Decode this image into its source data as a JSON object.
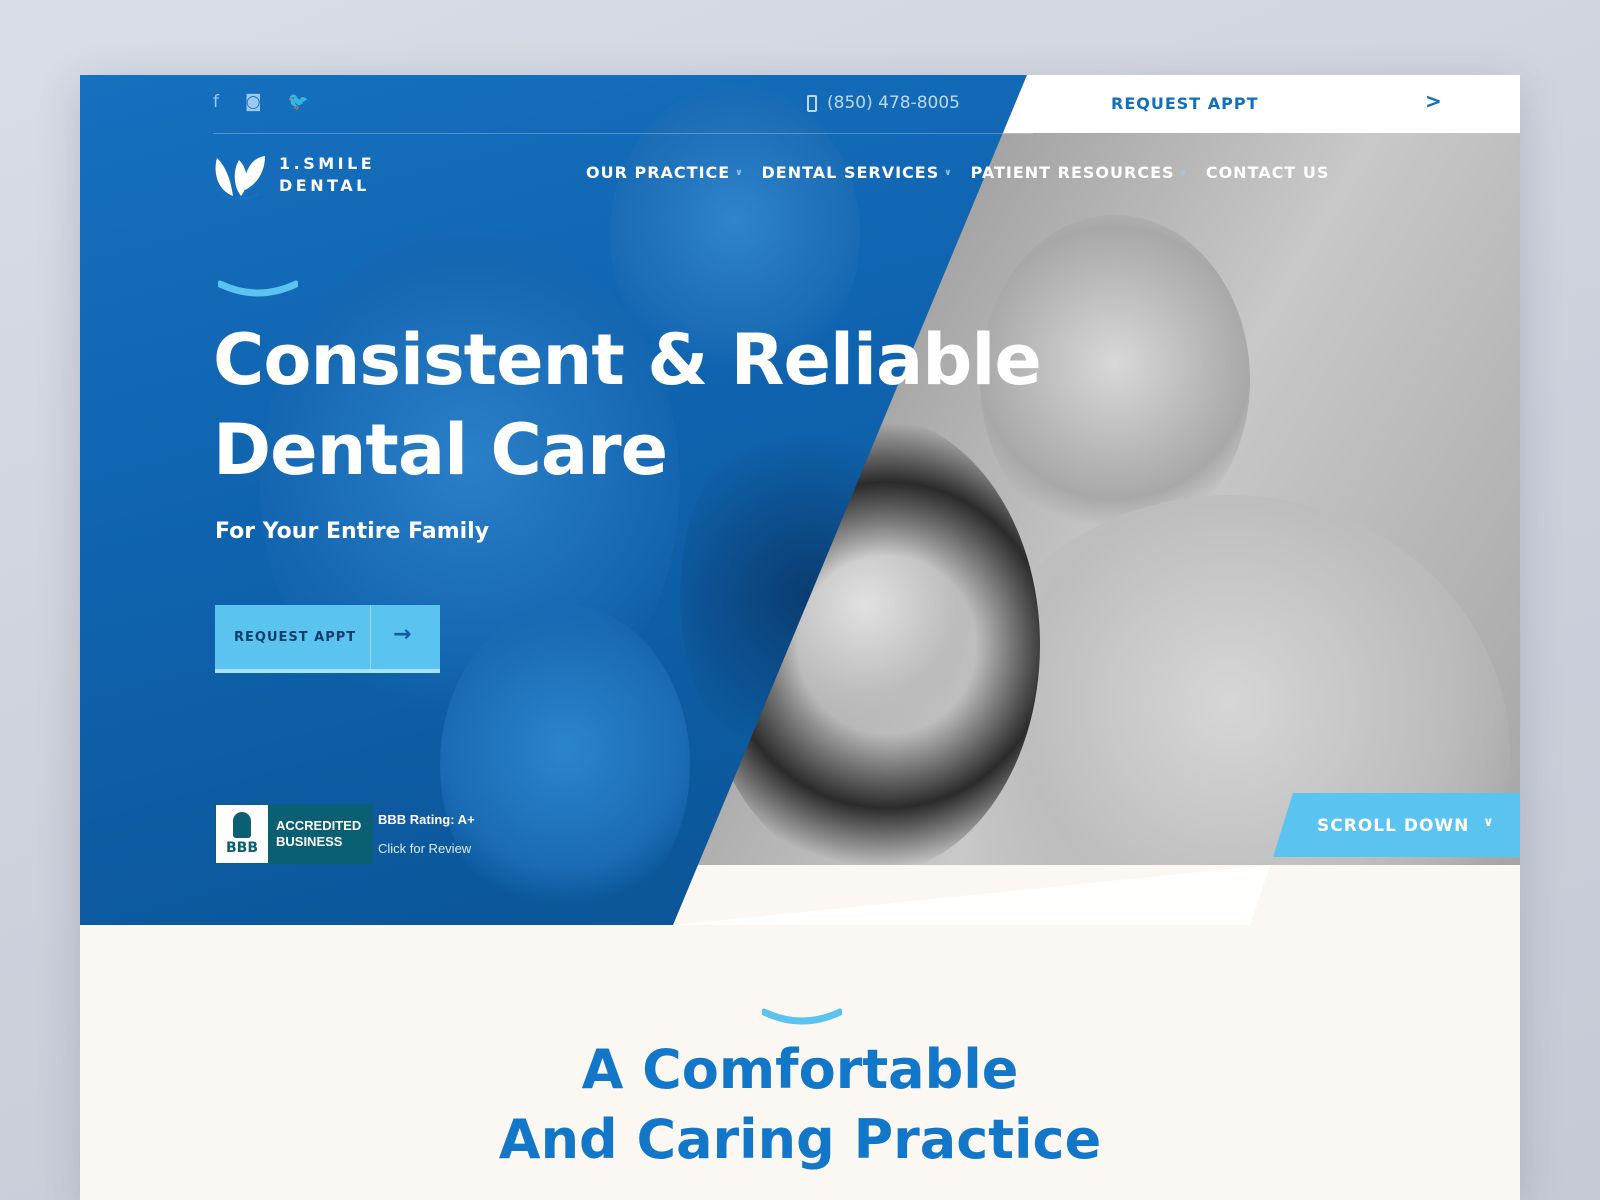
{
  "social": {
    "facebook_glyph": "f",
    "instagram_glyph": "◙",
    "twitter_glyph": "🐦"
  },
  "topbar": {
    "phone": "(850) 478-8005",
    "request_label": "REQUEST APPT",
    "request_arrow": ">"
  },
  "logo": {
    "line1": "1.SMILE",
    "line2": "DENTAL"
  },
  "nav": {
    "items": [
      {
        "label": "OUR PRACTICE",
        "chevron": "∨"
      },
      {
        "label": "DENTAL SERVICES",
        "chevron": "∨"
      },
      {
        "label": "PATIENT RESOURCES",
        "chevron": "∨"
      },
      {
        "label": "CONTACT US"
      }
    ]
  },
  "hero": {
    "headline_line1": "Consistent & Reliable",
    "headline_line2": "Dental Care",
    "subhead": "For Your Entire Family",
    "cta_label": "REQUEST APPT",
    "cta_arrow": "→"
  },
  "bbb": {
    "seal": "BBB",
    "accredited_line1": "ACCREDITED",
    "accredited_line2": "BUSINESS",
    "rating": "BBB Rating: A+",
    "click": "Click for Review"
  },
  "scroll": {
    "label": "SCROLL DOWN",
    "chevron": "∨"
  },
  "section": {
    "title_line1": "A Comfortable",
    "title_line2": "And Caring Practice"
  },
  "colors": {
    "brand_blue": "#0f6fc0",
    "accent_cyan": "#5bc3ef",
    "bbb_teal": "#0b5f73"
  }
}
